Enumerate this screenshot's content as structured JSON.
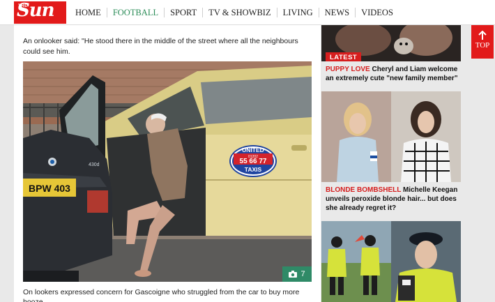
{
  "header": {
    "logo_the": "THE",
    "logo_sun": "Sun",
    "nav": [
      "HOME",
      "FOOTBALL",
      "SPORT",
      "TV & SHOWBIZ",
      "LIVING",
      "NEWS",
      "VIDEOS"
    ],
    "active_nav": "FOOTBALL"
  },
  "article": {
    "quote": "An onlooker said: \"He stood there in the middle of the street where all the neighbours could see him.",
    "photo": {
      "count": "7",
      "taxi_company": "UNITED",
      "taxi_phone_small": "01202",
      "taxi_phone": "55 66 77",
      "taxi_word": "TAXIS",
      "plate": "BPW 403",
      "badge": "430d"
    },
    "caption": "On lookers expressed concern for Gascoigne who struggled from the car to buy more booze"
  },
  "sidebar": {
    "items": [
      {
        "tag": "LATEST",
        "kicker": "PUPPY LOVE",
        "headline": "Cheryl and Liam welcome an extremely cute \"new family member\""
      },
      {
        "kicker": "BLONDE BOMBSHELL",
        "headline": "Michelle Keegan unveils peroxide blonde hair... but does she already regret it?"
      },
      {
        "kicker": "",
        "headline": ""
      }
    ]
  },
  "top_button": {
    "label": "TOP"
  },
  "colors": {
    "brand_red": "#e21a1a",
    "kicker_red": "#d61e1e",
    "active_green": "#2a8c57",
    "photo_badge": "#2f8a67"
  },
  "icons": {
    "camera": "camera-icon",
    "up": "arrow-up-icon"
  }
}
